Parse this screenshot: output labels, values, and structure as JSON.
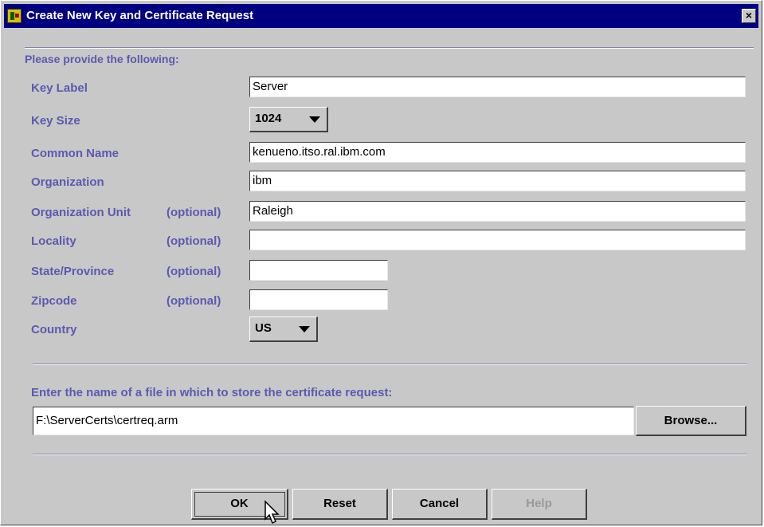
{
  "window": {
    "title": "Create New Key and Certificate Request",
    "close_glyph": "×"
  },
  "form": {
    "heading": "Please provide the following:",
    "key_label": {
      "label": "Key Label",
      "value": "Server"
    },
    "key_size": {
      "label": "Key Size",
      "selected": "1024"
    },
    "common_name": {
      "label": "Common Name",
      "value": "kenueno.itso.ral.ibm.com"
    },
    "organization": {
      "label": "Organization",
      "value": "ibm"
    },
    "organization_unit": {
      "label": "Organization Unit",
      "optional": "(optional)",
      "value": "Raleigh"
    },
    "locality": {
      "label": "Locality",
      "optional": "(optional)",
      "value": ""
    },
    "state_province": {
      "label": "State/Province",
      "optional": "(optional)",
      "value": ""
    },
    "zipcode": {
      "label": "Zipcode",
      "optional": "(optional)",
      "value": ""
    },
    "country": {
      "label": "Country",
      "selected": "US"
    }
  },
  "file": {
    "prompt": "Enter the name of a file in which to store the certificate request:",
    "value": "F:\\ServerCerts\\certreq.arm",
    "browse_label": "Browse..."
  },
  "buttons": {
    "ok": "OK",
    "reset": "Reset",
    "cancel": "Cancel",
    "help": "Help"
  },
  "icons": {
    "window": "key-certificate-icon",
    "close": "close-icon",
    "dropdown": "chevron-down-icon",
    "cursor": "mouse-pointer-icon"
  },
  "colors": {
    "titlebar": "#000080",
    "label": "#5a5ab0",
    "panel": "#c8c8c8"
  }
}
